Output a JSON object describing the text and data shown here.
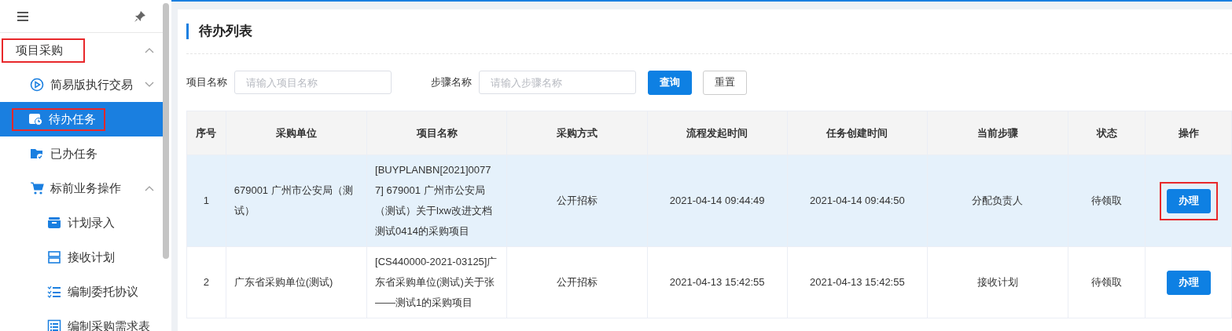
{
  "sidebar": {
    "items": [
      {
        "label": "项目采购",
        "expanded": true,
        "selected": false,
        "highlighted": true,
        "children": [
          {
            "label": "简易版执行交易",
            "expanded": false,
            "selected": false,
            "highlighted": false
          },
          {
            "label": "待办任务",
            "selected": true,
            "highlighted": true
          },
          {
            "label": "已办任务",
            "selected": false,
            "highlighted": false
          },
          {
            "label": "标前业务操作",
            "expanded": true,
            "selected": false,
            "highlighted": false,
            "children": [
              {
                "label": "计划录入",
                "selected": false,
                "highlighted": false
              },
              {
                "label": "接收计划",
                "selected": false,
                "highlighted": false
              },
              {
                "label": "编制委托协议",
                "selected": false,
                "highlighted": false
              },
              {
                "label": "编制采购需求表",
                "selected": false,
                "highlighted": false
              }
            ]
          }
        ]
      }
    ]
  },
  "page": {
    "title": "待办列表"
  },
  "filters": [
    {
      "label": "项目名称",
      "placeholder": "请输入项目名称"
    },
    {
      "label": "步骤名称",
      "placeholder": "请输入步骤名称"
    }
  ],
  "buttons": [
    {
      "label": "查询",
      "kind": "primary"
    },
    {
      "label": "重置",
      "kind": "default"
    }
  ],
  "table": {
    "columns": [
      "序号",
      "采购单位",
      "项目名称",
      "采购方式",
      "流程发起时间",
      "任务创建时间",
      "当前步骤",
      "状态",
      "操作"
    ],
    "rows": [
      {
        "selected": true,
        "cells": [
          "1",
          "679001 广州市公安局（测试）",
          "[BUYPLANBN[2021]00777] 679001 广州市公安局（测试）关于lxw改进文档测试0414的采购项目",
          "公开招标",
          "2021-04-14 09:44:49",
          "2021-04-14 09:44:50",
          "分配负责人",
          "待领取"
        ],
        "action": "办理",
        "action_highlighted": true
      },
      {
        "selected": false,
        "cells": [
          "2",
          "广东省采购单位(测试)",
          "[CS440000-2021-03125]广东省采购单位(测试)关于张——测试1的采购项目",
          "公开招标",
          "2021-04-13 15:42:55",
          "2021-04-13 15:42:55",
          "接收计划",
          "待领取"
        ],
        "action": "办理",
        "action_highlighted": false
      }
    ]
  }
}
